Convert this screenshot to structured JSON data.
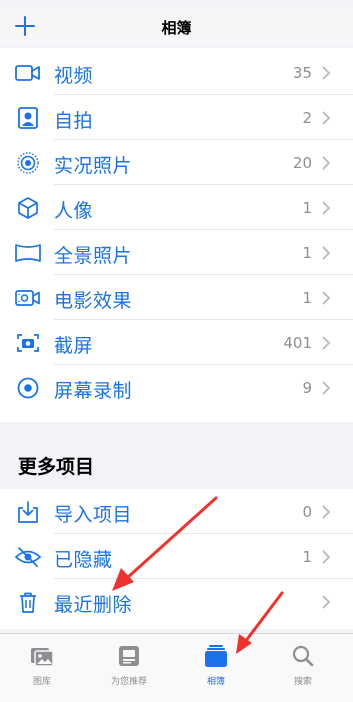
{
  "header": {
    "title": "相簿",
    "add_icon": "plus-icon"
  },
  "media_types": [
    {
      "label": "视频",
      "count": "35",
      "icon": "video-icon"
    },
    {
      "label": "自拍",
      "count": "2",
      "icon": "selfie-portrait-icon"
    },
    {
      "label": "实况照片",
      "count": "20",
      "icon": "live-photo-icon"
    },
    {
      "label": "人像",
      "count": "1",
      "icon": "cube-portrait-icon"
    },
    {
      "label": "全景照片",
      "count": "1",
      "icon": "panorama-icon"
    },
    {
      "label": "电影效果",
      "count": "1",
      "icon": "cinematic-icon"
    },
    {
      "label": "截屏",
      "count": "401",
      "icon": "screenshot-icon"
    },
    {
      "label": "屏幕录制",
      "count": "9",
      "icon": "screen-record-icon"
    }
  ],
  "more": {
    "title": "更多项目",
    "items": [
      {
        "label": "导入项目",
        "count": "0",
        "icon": "import-icon"
      },
      {
        "label": "已隐藏",
        "count": "1",
        "icon": "hidden-eye-icon"
      },
      {
        "label": "最近删除",
        "count": "",
        "icon": "trash-icon"
      }
    ]
  },
  "tabbar": {
    "tabs": [
      {
        "label": "图库",
        "icon": "library-icon",
        "active": false
      },
      {
        "label": "为您推荐",
        "icon": "for-you-icon",
        "active": false
      },
      {
        "label": "相簿",
        "icon": "albums-icon",
        "active": true
      },
      {
        "label": "搜索",
        "icon": "search-icon",
        "active": false
      }
    ]
  },
  "colors": {
    "accent": "#1a73e8",
    "annotation_arrow": "#f0322d",
    "secondary_text": "#8e8e93"
  }
}
